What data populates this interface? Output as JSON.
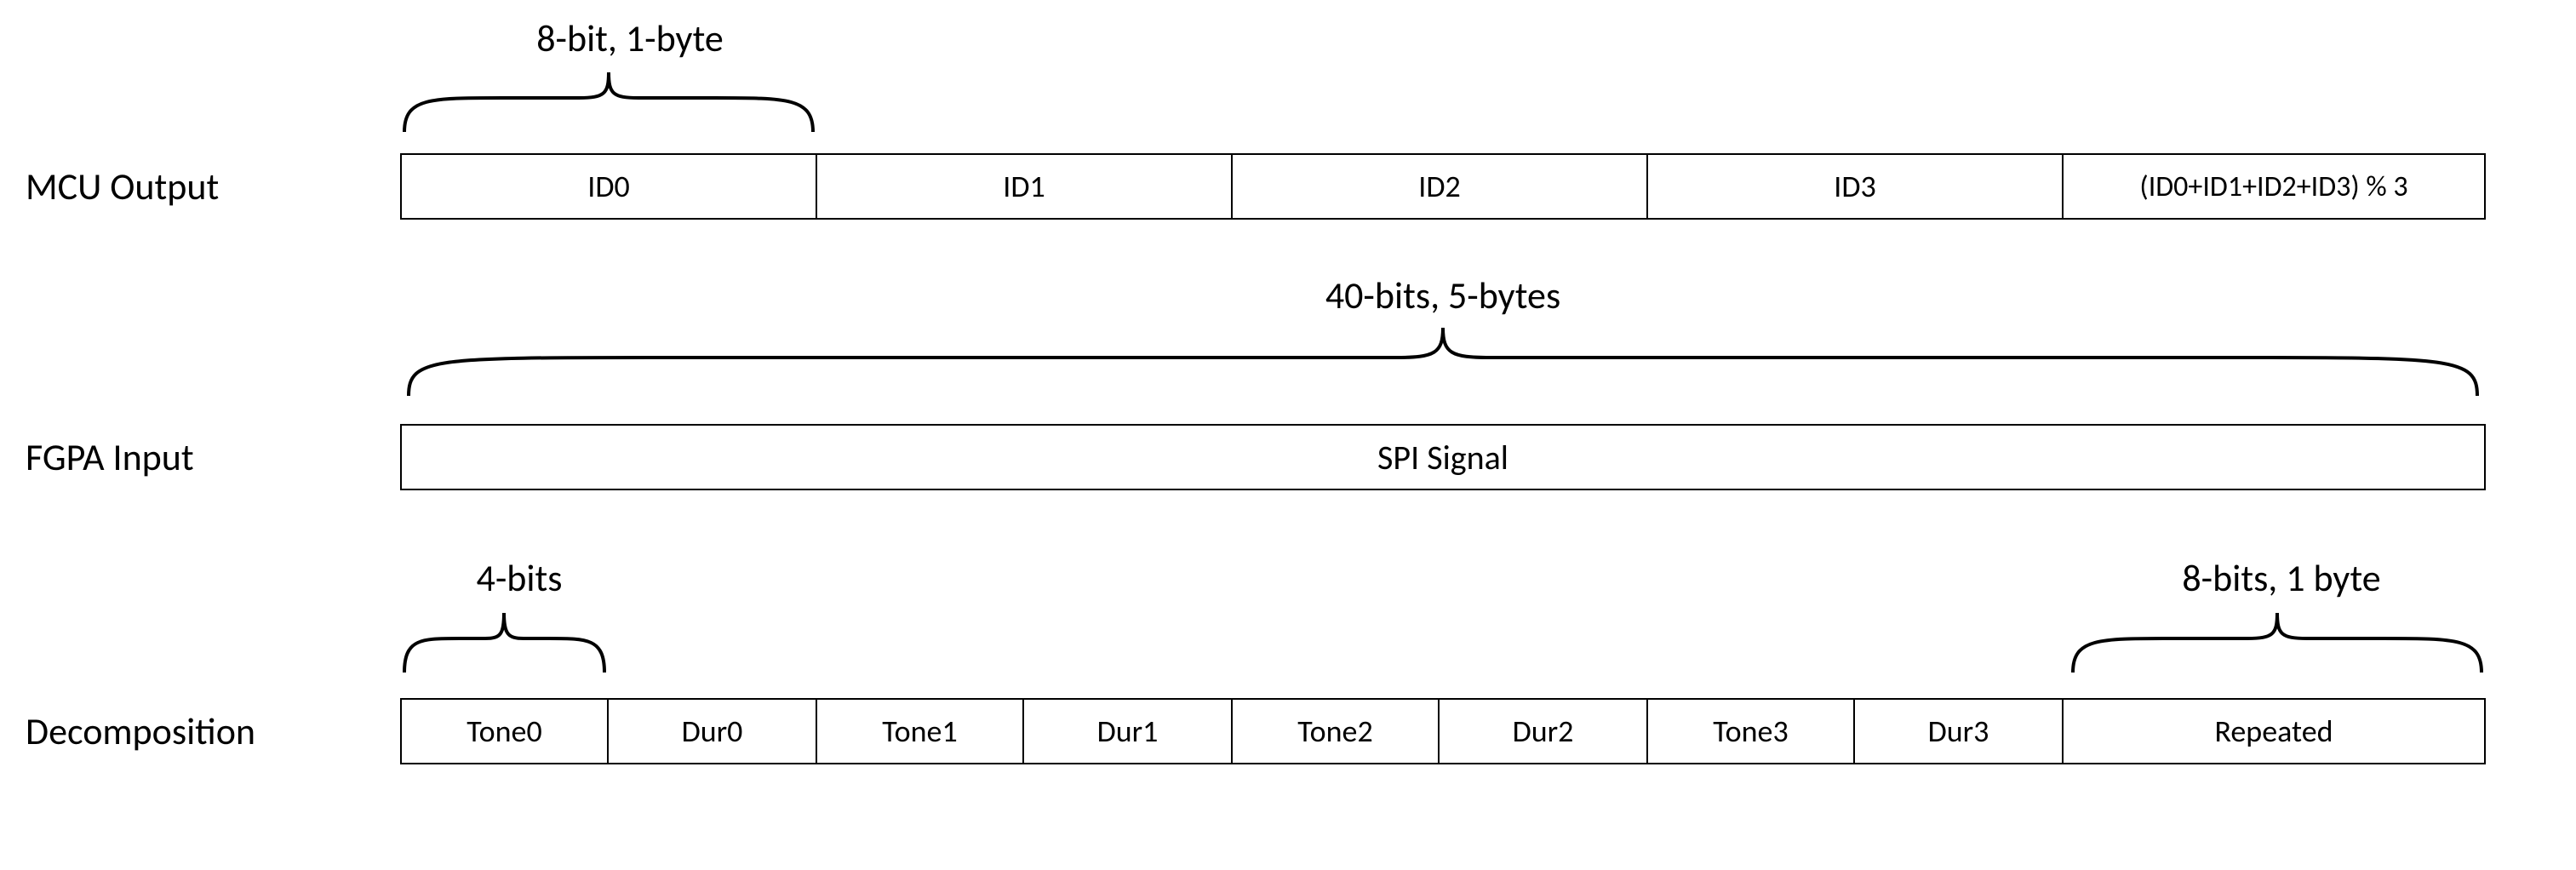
{
  "labels": {
    "mcu": "MCU Output",
    "fpga": "FGPA Input",
    "decomp": "Decomposition"
  },
  "annotations": {
    "top_small": "8-bit, 1-byte",
    "mid_full": "40-bits, 5-bytes",
    "bot_left": "4-bits",
    "bot_right": "8-bits, 1 byte"
  },
  "mcu_row": {
    "c0": "ID0",
    "c1": "ID1",
    "c2": "ID2",
    "c3": "ID3",
    "c4": "(ID0+ID1+ID2+ID3) % 3"
  },
  "fpga_row": {
    "full": "SPI Signal"
  },
  "decomp_row": {
    "c0": "Tone0",
    "c1": "Dur0",
    "c2": "Tone1",
    "c3": "Dur1",
    "c4": "Tone2",
    "c5": "Dur2",
    "c6": "Tone3",
    "c7": "Dur3",
    "c8": "Repeated"
  }
}
